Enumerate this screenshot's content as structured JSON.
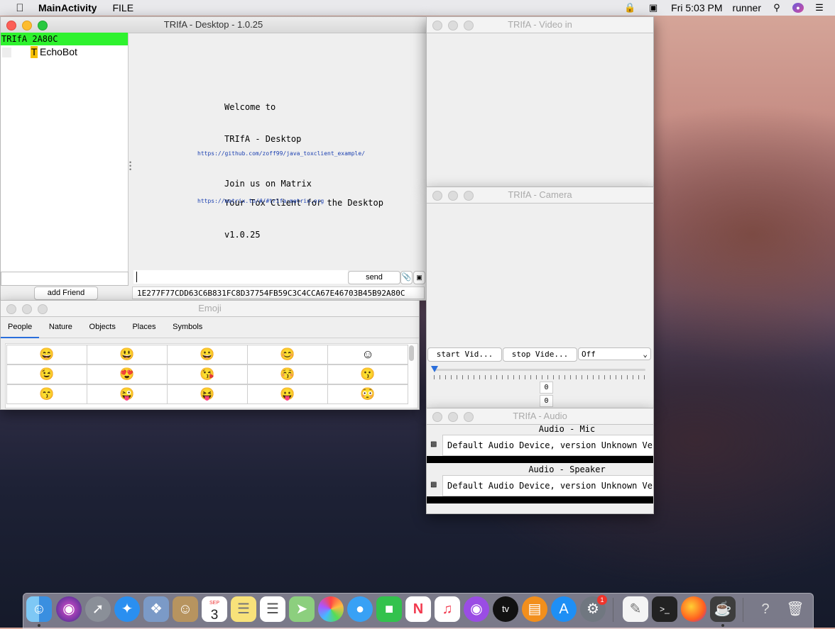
{
  "menubar": {
    "app_name": "MainActivity",
    "menu_file": "FILE",
    "clock": "Fri 5:03 PM",
    "user": "runner",
    "icons": [
      "lock-icon",
      "display-icon",
      "search-icon",
      "siri-icon",
      "control-center-icon"
    ]
  },
  "main_window": {
    "title": "TRIfA - Desktop - 1.0.25",
    "self_id_label": "TRIfA 2A80C",
    "friend_initial": "T",
    "friend_name": "EchoBot",
    "add_friend_label": "add Friend",
    "welcome_lines": [
      "Welcome to",
      "TRIfA - Desktop",
      "",
      "Your Tox Client for the Desktop",
      "v1.0.25"
    ],
    "github_link": "https://github.com/zoff99/java_toxclient_example/",
    "matrix_title": "Join us on Matrix",
    "matrix_link": "https://matrix.to/#/#trifa:matrix.org",
    "send_label": "send",
    "tox_id": "1E277F77CDD63C6B831FC8D37754FB59C3C4CCA67E46703B45B92A80C"
  },
  "emoji_window": {
    "title": "Emoji",
    "tabs": [
      "People",
      "Nature",
      "Objects",
      "Places",
      "Symbols"
    ],
    "active_tab": "People",
    "rows": [
      [
        "😄",
        "😃",
        "😀",
        "😊",
        "☺"
      ],
      [
        "😉",
        "😍",
        "😘",
        "😚",
        "😗"
      ],
      [
        "😙",
        "😜",
        "😝",
        "😛",
        "😳"
      ]
    ]
  },
  "video_in_window": {
    "title": "TRIfA - Video in"
  },
  "camera_window": {
    "title": "TRIfA - Camera",
    "start_label": "start Vid...",
    "stop_label": "stop Vide...",
    "select_value": "Off",
    "slider_value": 0,
    "readout_1": "0",
    "readout_2": "0"
  },
  "audio_window": {
    "title": "TRIfA - Audio",
    "mic_heading": "Audio - Mic",
    "mic_device": "Default Audio Device, version Unknown Vers",
    "speaker_heading": "Audio - Speaker",
    "speaker_device": "Default Audio Device, version Unknown Vers"
  },
  "dock": {
    "calendar_month": "SEP",
    "calendar_day": "3",
    "settings_badge": "1",
    "apps": [
      "finder-icon",
      "siri-icon",
      "launchpad-icon",
      "safari-icon",
      "preview-icon",
      "contacts-icon",
      "calendar-icon",
      "notes-icon",
      "reminders-icon",
      "maps-icon",
      "photos-icon",
      "messages-icon",
      "facetime-icon",
      "news-icon",
      "music-icon",
      "podcasts-icon",
      "tv-icon",
      "books-icon",
      "app-store-icon",
      "system-preferences-icon",
      "textedit-icon",
      "terminal-icon",
      "firefox-icon",
      "java-icon",
      "help-icon",
      "trash-icon"
    ]
  }
}
